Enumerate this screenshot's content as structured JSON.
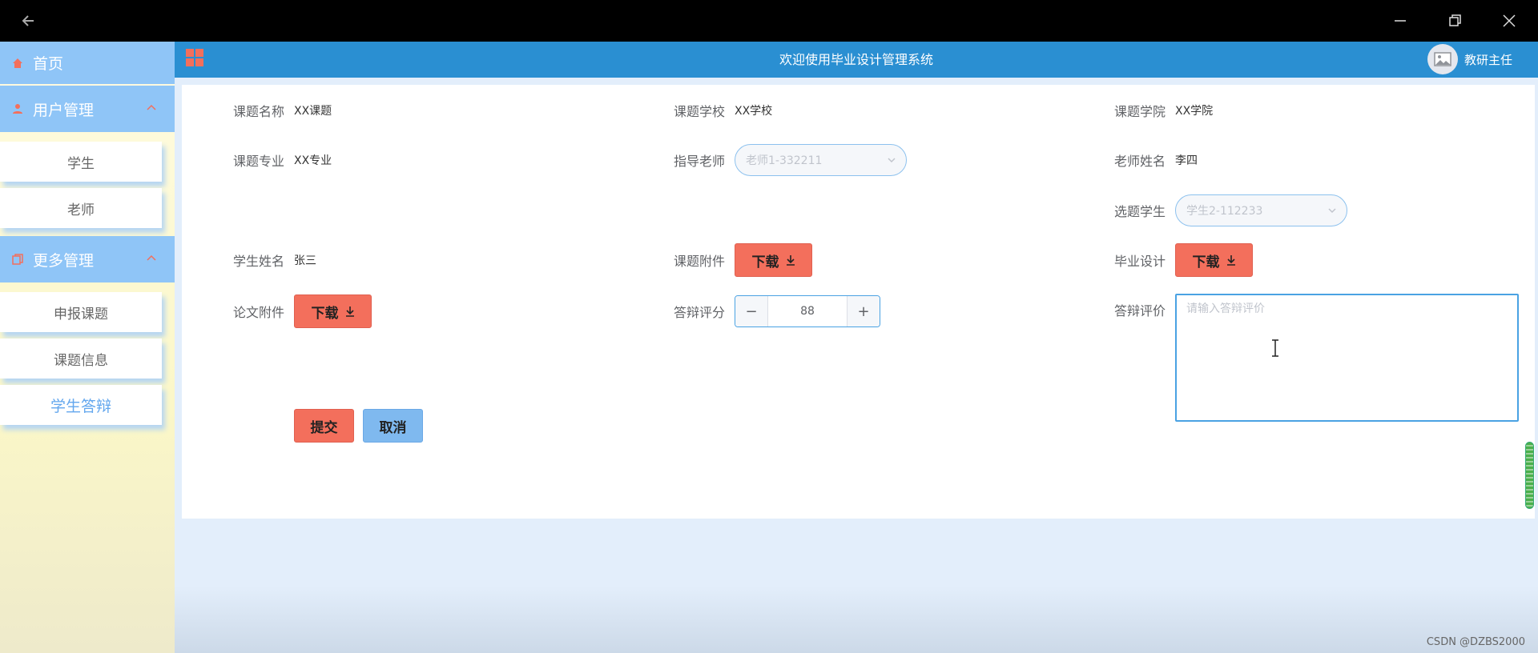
{
  "window": {
    "back_icon": "arrow-left-icon",
    "controls": [
      "minimize-icon",
      "restore-icon",
      "close-icon"
    ]
  },
  "sidebar": {
    "home": {
      "label": "首页",
      "icon": "home-icon"
    },
    "groups": [
      {
        "label": "用户管理",
        "icon": "user-icon",
        "items": [
          "学生",
          "老师"
        ]
      },
      {
        "label": "更多管理",
        "icon": "copy-icon",
        "items": [
          "申报课题",
          "课题信息",
          "学生答辩"
        ],
        "active": "学生答辩"
      }
    ]
  },
  "header": {
    "title": "欢迎使用毕业设计管理系统",
    "user": "教研主任",
    "menu_icon": "grid-icon",
    "avatar_icon": "image-icon"
  },
  "form": {
    "topic_name": {
      "label": "课题名称",
      "value": "XX课题"
    },
    "topic_school": {
      "label": "课题学校",
      "value": "XX学校"
    },
    "topic_college": {
      "label": "课题学院",
      "value": "XX学院"
    },
    "topic_major": {
      "label": "课题专业",
      "value": "XX专业"
    },
    "advisor": {
      "label": "指导老师",
      "placeholder": "老师1-332211"
    },
    "teacher_name": {
      "label": "老师姓名",
      "value": "李四"
    },
    "selected_student": {
      "label": "选题学生",
      "placeholder": "学生2-112233"
    },
    "student_name": {
      "label": "学生姓名",
      "value": "张三"
    },
    "topic_attachment": {
      "label": "课题附件",
      "button": "下载"
    },
    "graduation_design": {
      "label": "毕业设计",
      "button": "下载"
    },
    "thesis_attachment": {
      "label": "论文附件",
      "button": "下载"
    },
    "defense_score": {
      "label": "答辩评分",
      "value": "88",
      "minus": "−",
      "plus": "+"
    },
    "defense_comment": {
      "label": "答辩评价",
      "placeholder": "请输入答辩评价"
    },
    "submit": "提交",
    "cancel": "取消"
  },
  "colors": {
    "primary": "#2a8fd2",
    "danger": "#f36f5c",
    "sidebar_blue": "#8fc5f7"
  },
  "watermark": "CSDN @DZBS2000"
}
